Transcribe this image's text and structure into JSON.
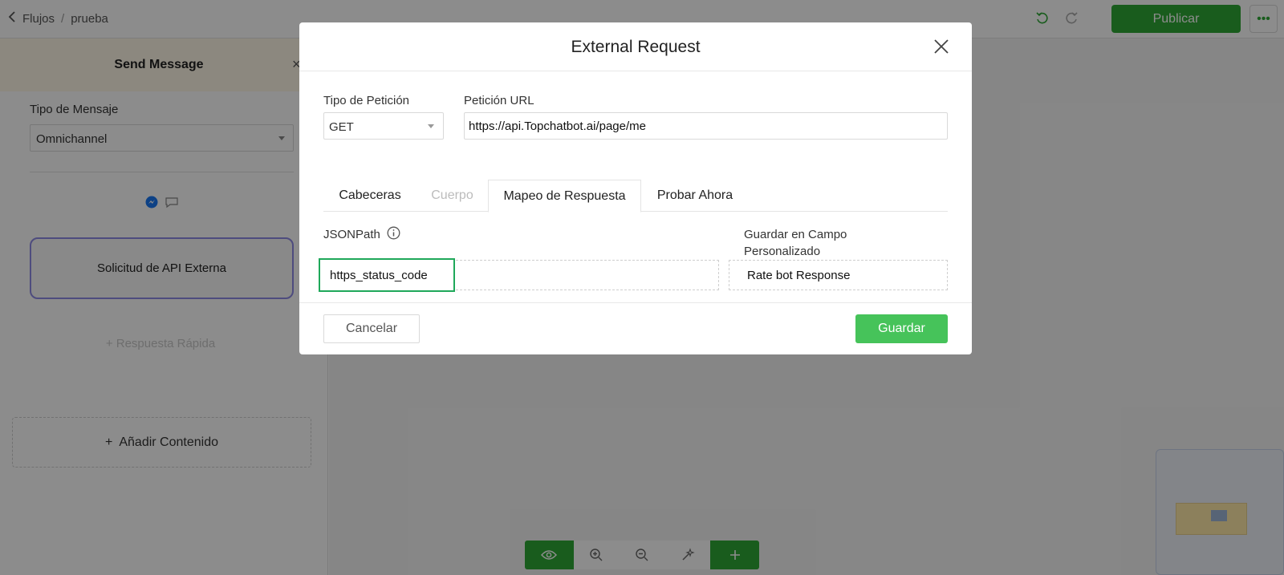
{
  "topbar": {
    "breadcrumb_root": "Flujos",
    "breadcrumb_sep": "/",
    "breadcrumb_current": "prueba",
    "publish_label": "Publicar",
    "more_label": "•••"
  },
  "left_panel": {
    "title": "Send Message",
    "close_label": "×",
    "message_type_label": "Tipo de Mensaje",
    "message_type_value": "Omnichannel",
    "card_label": "Solicitud de API Externa",
    "quick_reply_label": "+ Respuesta Rápida",
    "add_content_plus": "+",
    "add_content_label": "Añadir Contenido"
  },
  "modal": {
    "title": "External Request",
    "request_type_label": "Tipo de Petición",
    "request_type_value": "GET",
    "url_label": "Petición URL",
    "url_value": "https://api.Topchatbot.ai/page/me",
    "tabs": [
      {
        "label": "Cabeceras"
      },
      {
        "label": "Cuerpo"
      },
      {
        "label": "Mapeo de Respuesta"
      },
      {
        "label": "Probar Ahora"
      }
    ],
    "jsonpath_label": "JSONPath",
    "jsonpath_value": "https_status_code",
    "custom_field_label": "Guardar en Campo Personalizado",
    "custom_field_value": "Rate bot Response",
    "cancel_label": "Cancelar",
    "save_label": "Guardar"
  },
  "colors": {
    "accent_green": "#2ea836",
    "save_green": "#46c35a",
    "highlight_border": "#1fa85a",
    "card_border": "#8e8ae6"
  },
  "icons": [
    "chevron-left-icon",
    "undo-icon",
    "redo-icon",
    "messenger-icon",
    "chat-bubble-icon",
    "close-icon",
    "info-icon",
    "eye-icon",
    "zoom-in-icon",
    "zoom-out-icon",
    "magic-icon",
    "plus-icon"
  ]
}
